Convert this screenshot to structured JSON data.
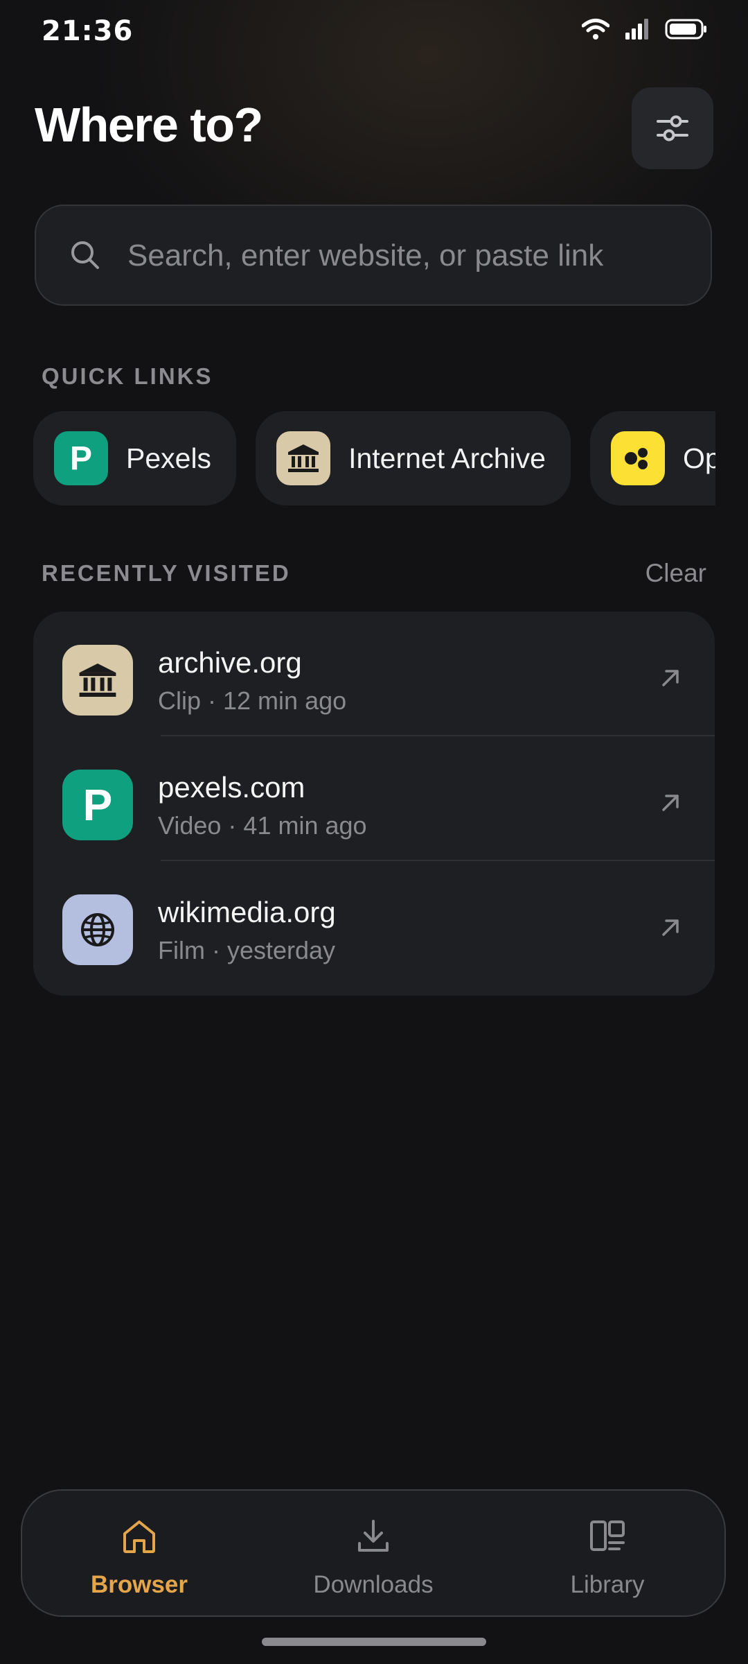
{
  "status_bar": {
    "time": "21:36"
  },
  "header": {
    "title": "Where to?"
  },
  "search": {
    "placeholder": "Search, enter website, or paste link"
  },
  "quick_links": {
    "label": "QUICK LINKS",
    "items": [
      {
        "label": "Pexels",
        "icon_letter": "P",
        "icon": "pexels-icon",
        "color": "#0fa07f"
      },
      {
        "label": "Internet Archive",
        "icon": "archive-building-icon",
        "color": "#d8c9a8"
      },
      {
        "label": "Openverse",
        "icon": "openverse-icon",
        "color": "#fde034"
      }
    ]
  },
  "recent": {
    "label": "RECENTLY VISITED",
    "clear_label": "Clear",
    "items": [
      {
        "domain": "archive.org",
        "meta": "Clip · 12 min ago",
        "icon": "archive-building-icon",
        "color": "#d8c9a8"
      },
      {
        "domain": "pexels.com",
        "meta": "Video · 41 min ago",
        "icon": "pexels-icon",
        "icon_letter": "P",
        "color": "#0fa07f"
      },
      {
        "domain": "wikimedia.org",
        "meta": "Film · yesterday",
        "icon": "globe-icon",
        "color": "#b4bedf"
      }
    ]
  },
  "tabs": [
    {
      "label": "Browser",
      "icon": "home-icon",
      "active": true
    },
    {
      "label": "Downloads",
      "icon": "download-icon",
      "active": false
    },
    {
      "label": "Library",
      "icon": "library-icon",
      "active": false
    }
  ],
  "colors": {
    "accent": "#e5a54a",
    "background": "#121214",
    "card": "#1e1f22"
  }
}
